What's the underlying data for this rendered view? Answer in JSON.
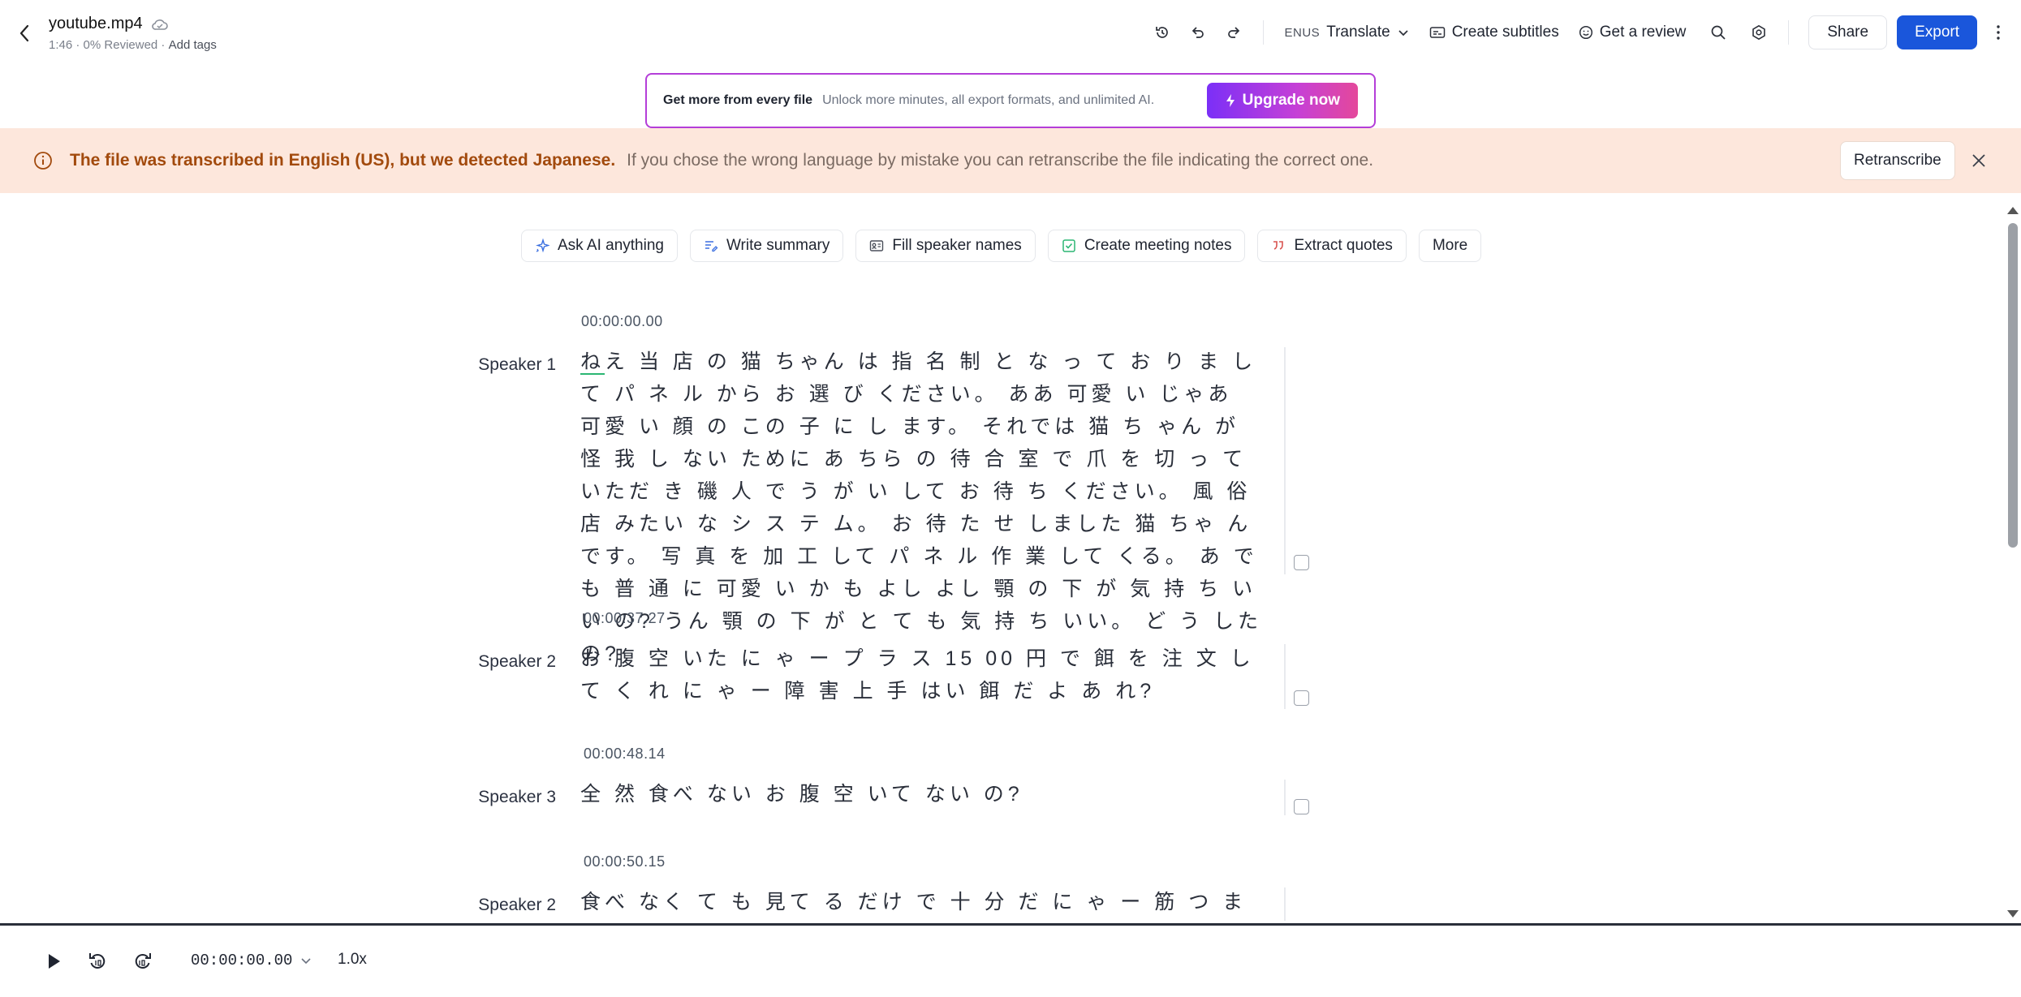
{
  "header": {
    "file_name": "youtube.mp4",
    "duration": "1:46",
    "reviewed": "0% Reviewed",
    "add_tags": "Add tags",
    "lang_code": "ENUS",
    "translate_label": "Translate",
    "create_subtitles_label": "Create subtitles",
    "get_review_label": "Get a review",
    "share_label": "Share",
    "export_label": "Export"
  },
  "promo": {
    "title": "Get more from every file",
    "text": "Unlock more minutes, all export formats, and unlimited AI.",
    "button_label": "Upgrade now"
  },
  "warning": {
    "strong_text": "The file was transcribed in English (US), but we detected Japanese.",
    "text": "If you chose the wrong language by mistake you can retranscribe the file indicating the correct one.",
    "button_label": "Retranscribe"
  },
  "ai_chips": [
    {
      "label": "Ask AI anything"
    },
    {
      "label": "Write summary"
    },
    {
      "label": "Fill speaker names"
    },
    {
      "label": "Create meeting notes"
    },
    {
      "label": "Extract quotes"
    },
    {
      "label": "More"
    }
  ],
  "segments": [
    {
      "timestamp": "00:00:00.00",
      "speaker": "Speaker 1",
      "first_char": "ね",
      "text": "え 当 店 の 猫 ちゃん は 指 名 制 と な っ て お り ま し て パ ネ ル から お 選 び ください。 ああ 可愛 い じゃあ 可愛 い 顔 の この 子 に し ます。 それでは 猫 ち ゃん が 怪 我 し ない ために あ ちら の 待 合 室 で 爪 を 切 っ て いただ き 磯 人 で う が い して お 待 ち ください。 風 俗 店 みたい な シ ス テ ム。 お 待 た せ しました 猫 ちゃ んです。 写 真 を 加 工 して パ ネ ル 作 業 して くる。 あ でも 普 通 に 可愛 い か も よし よし 顎 の 下 が 気 持 ち いい の? うん 顎 の 下 が と て も 気 持 ち いい。 ど う した の?"
    },
    {
      "timestamp": "00:00:37.27",
      "speaker": "Speaker 2",
      "first_char": "",
      "text": "お 腹 空 いた に ゃ ー プ ラ ス 15 00 円 で 餌 を 注 文 して く れ に ゃ ー 障 害 上 手 はい 餌 だ よ あ れ?"
    },
    {
      "timestamp": "00:00:48.14",
      "speaker": "Speaker 3",
      "first_char": "",
      "text": "全 然 食べ ない お 腹 空 いて ない の?"
    },
    {
      "timestamp": "00:00:50.15",
      "speaker": "Speaker 2",
      "first_char": "",
      "text": "食べ なく て も 見て る だけ で 十 分 だ に ゃ ー 筋 つ ま 合 わ せて く る あ ー 人"
    }
  ],
  "player": {
    "time": "00:00:00.00",
    "speed": "1.0x"
  },
  "colors": {
    "accent": "#1a56db",
    "warning_bg": "#fde7dc",
    "warning_text": "#a24a0d",
    "promo_border": "#b43ed8",
    "highlight": "#2bb673"
  }
}
